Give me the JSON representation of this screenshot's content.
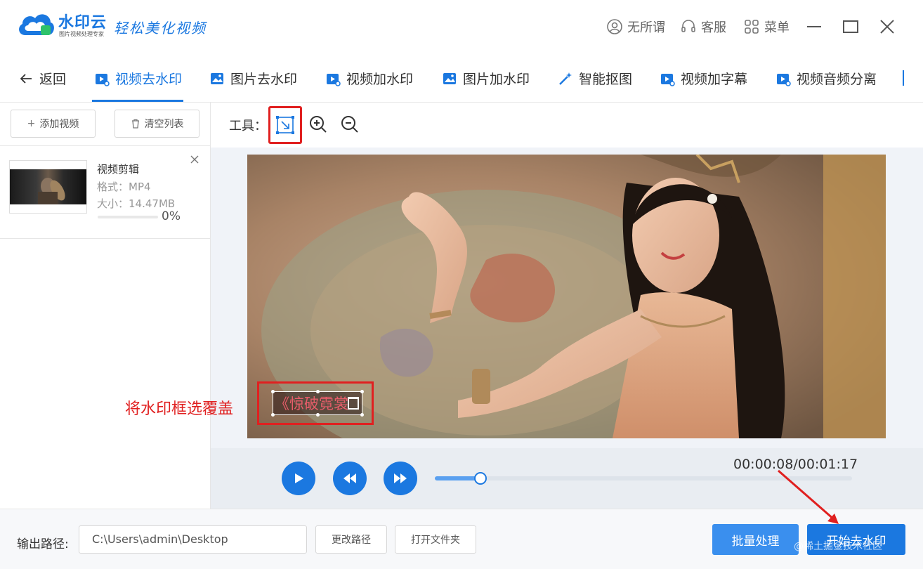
{
  "app": {
    "brand": "水印云",
    "brand_sub": "图片视频处理专家",
    "slogan": "轻松美化视频"
  },
  "titlebar": {
    "user_label": "无所谓",
    "service_label": "客服",
    "menu_label": "菜单"
  },
  "nav": {
    "back_label": "返回",
    "tabs": [
      {
        "label": "视频去水印",
        "active": true
      },
      {
        "label": "图片去水印"
      },
      {
        "label": "视频加水印"
      },
      {
        "label": "图片加水印"
      },
      {
        "label": "智能抠图"
      },
      {
        "label": "视频加字幕"
      },
      {
        "label": "视频音频分离"
      }
    ]
  },
  "sidebar": {
    "add_video_label": "添加视频",
    "clear_list_label": "清空列表",
    "files": [
      {
        "name": "视频剪辑",
        "format": "格式：MP4",
        "size": "大小：14.47MB",
        "progress_pct": "0%",
        "progress": 0
      }
    ]
  },
  "toolbar": {
    "tools_label": "工具："
  },
  "video": {
    "watermark_text": "《惊破霓裳",
    "annotation": "将水印框选覆盖"
  },
  "player": {
    "time": "00:00:08/00:01:17",
    "progress": 0.11
  },
  "bottom": {
    "output_label": "输出路径:",
    "output_path": "C:\\Users\\admin\\Desktop",
    "change_path_label": "更改路径",
    "open_folder_label": "打开文件夹",
    "batch_label": "批量处理",
    "start_label": "开始去水印",
    "credit": "@稀土掘金技术社区"
  },
  "colors": {
    "accent": "#1b78e0",
    "annotation_red": "#e02020"
  }
}
